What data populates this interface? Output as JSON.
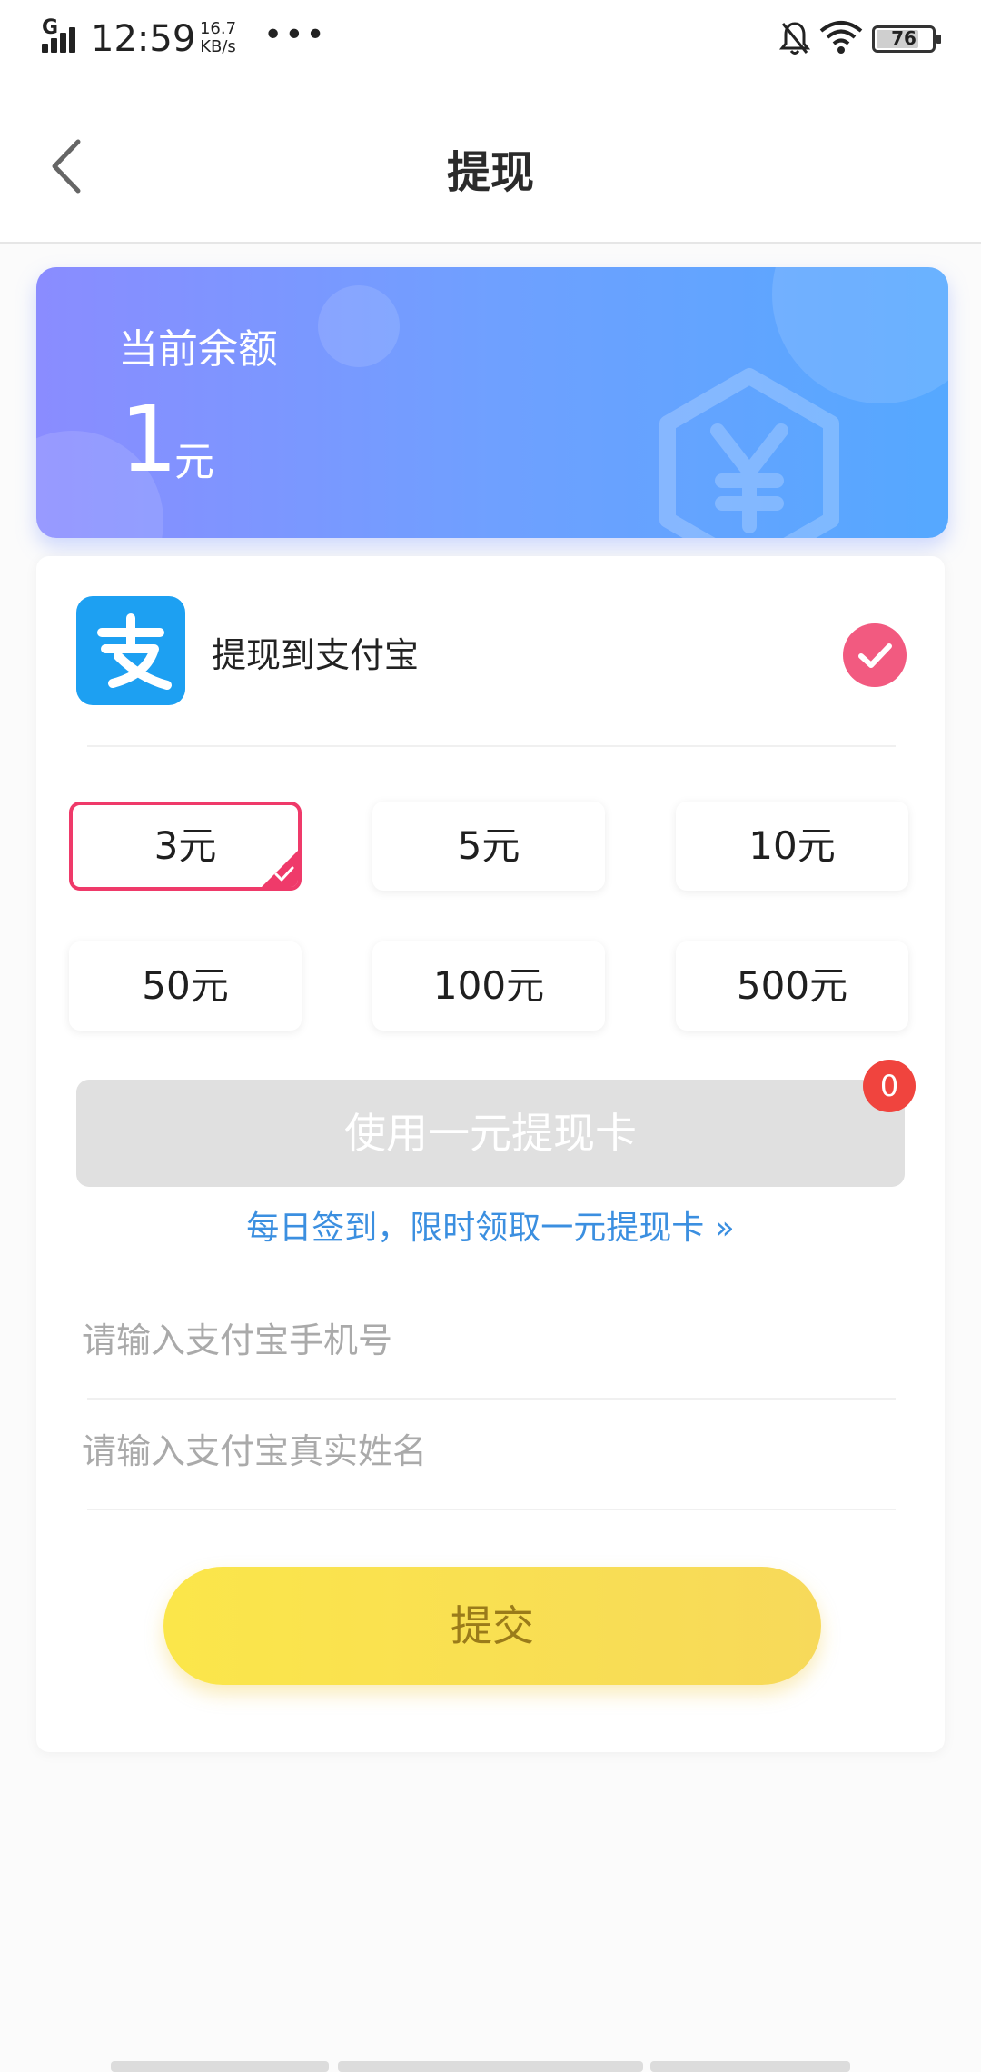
{
  "status_bar": {
    "network": "G",
    "time": "12:59",
    "speed_value": "16.7",
    "speed_unit": "KB/s",
    "more": "•••",
    "battery": "76",
    "battery_level": 0.76
  },
  "header": {
    "title": "提现"
  },
  "balance": {
    "label": "当前余额",
    "amount": "1",
    "unit": "元"
  },
  "payment_method": {
    "label": "提现到支付宝",
    "selected": true
  },
  "amounts": [
    {
      "label": "3元",
      "selected": true
    },
    {
      "label": "5元",
      "selected": false
    },
    {
      "label": "10元",
      "selected": false
    },
    {
      "label": "50元",
      "selected": false
    },
    {
      "label": "100元",
      "selected": false
    },
    {
      "label": "500元",
      "selected": false
    }
  ],
  "card": {
    "button_label": "使用一元提现卡",
    "badge_count": "0",
    "signin_link": "每日签到，限时领取一元提现卡 »"
  },
  "form": {
    "phone_placeholder": "请输入支付宝手机号",
    "name_placeholder": "请输入支付宝真实姓名"
  },
  "submit_label": "提交",
  "colors": {
    "accent_pink": "#ef3a6a",
    "link_blue": "#3b8fe0",
    "submit_yellow": "#f7d95a",
    "alipay_blue": "#1da0f2"
  }
}
